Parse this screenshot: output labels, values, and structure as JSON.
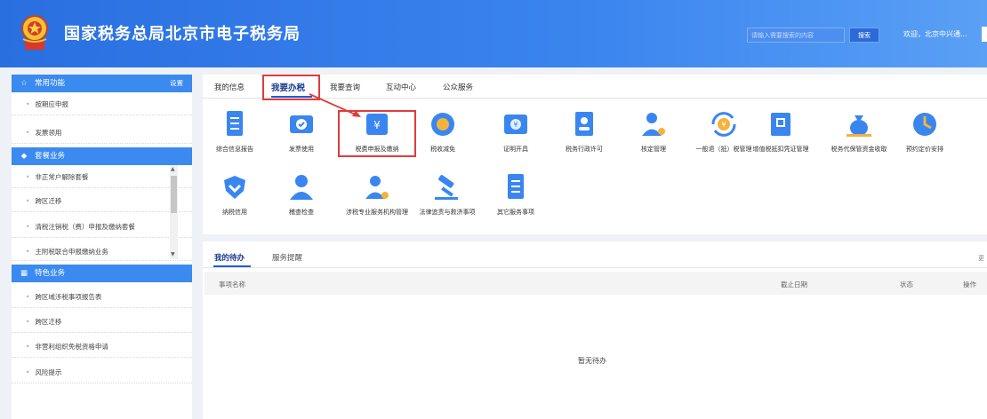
{
  "header": {
    "title": "国家税务总局北京市电子税务局",
    "search_placeholder": "请输入需要搜索的内容",
    "search_button": "搜索",
    "welcome": "欢迎，北京中兴通...",
    "colors": {
      "header_blue": "#2a6fe0",
      "accent_red": "#e03c3c"
    }
  },
  "sidebar": {
    "common": {
      "title": "常用功能",
      "settings": "设置",
      "items": [
        "按期应申报",
        "发票领用"
      ]
    },
    "packages": {
      "title": "套餐业务",
      "items": [
        "非正常户解除套餐",
        "跨区迁移",
        "清税注销税（费）申报及缴纳套餐",
        "主附税联合申报缴纳业务"
      ]
    },
    "special": {
      "title": "特色业务",
      "items": [
        "跨区域涉税事项报告表",
        "跨区迁移",
        "非营利组织免税资格申请",
        "风险提示"
      ]
    }
  },
  "tabs": [
    "我的信息",
    "我要办税",
    "我要查询",
    "互动中心",
    "公众服务"
  ],
  "services": [
    {
      "label": "综合信息报告",
      "icon": "document-list-icon"
    },
    {
      "label": "发票使用",
      "icon": "invoice-check-icon"
    },
    {
      "label": "税费申报及缴纳",
      "icon": "yuan-wallet-icon"
    },
    {
      "label": "税收减免",
      "icon": "tax-relief-icon"
    },
    {
      "label": "证明开具",
      "icon": "certificate-icon"
    },
    {
      "label": "税务行政许可",
      "icon": "id-card-icon"
    },
    {
      "label": "核定管理",
      "icon": "user-gear-icon"
    },
    {
      "label": "一般退（抵）税管理",
      "icon": "refund-cycle-icon"
    },
    {
      "label": "增值税抵扣凭证管理",
      "icon": "vat-voucher-icon"
    },
    {
      "label": "税务代保管资金收取",
      "icon": "money-bag-icon"
    },
    {
      "label": "预约定价安排",
      "icon": "pricing-icon"
    },
    {
      "label": "纳税信用",
      "icon": "credit-shield-icon"
    },
    {
      "label": "稽查检查",
      "icon": "inspector-icon"
    },
    {
      "label": "涉税专业服务机构管理",
      "icon": "agency-user-icon"
    },
    {
      "label": "法律追责与救济事项",
      "icon": "gavel-icon"
    },
    {
      "label": "其它服务事项",
      "icon": "other-list-icon"
    }
  ],
  "bottom_tabs": [
    "我的待办",
    "服务提醒"
  ],
  "more": "更",
  "table": {
    "columns": [
      "事项名称",
      "截止日期",
      "状态",
      "操作"
    ],
    "empty_text": "暂无待办"
  }
}
